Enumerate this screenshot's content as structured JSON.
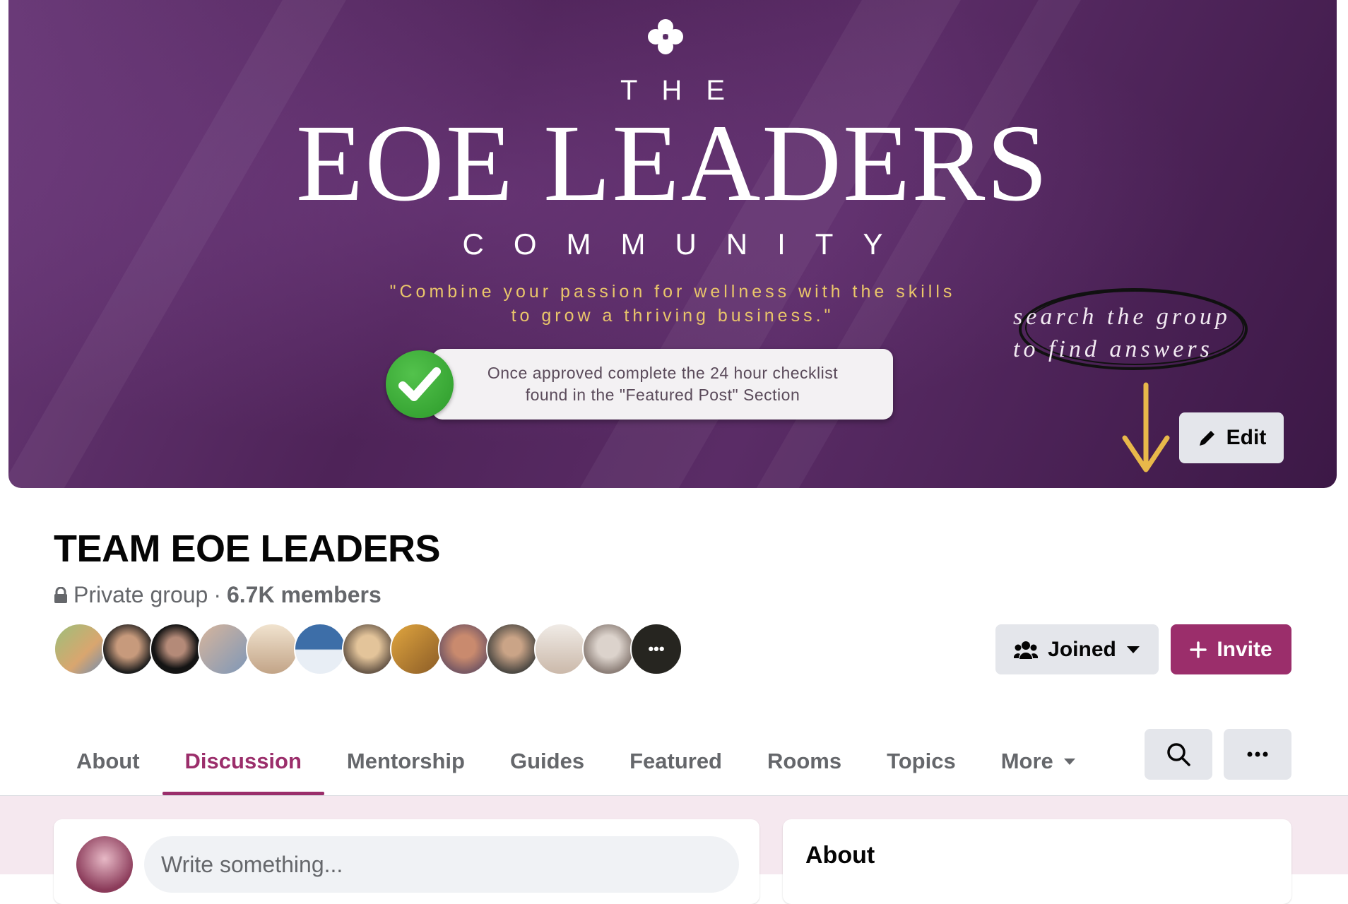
{
  "cover": {
    "the": "THE",
    "title": "EOE LEADERS",
    "community": "COMMUNITY",
    "quote_line1": "\"Combine your passion for wellness with the skills",
    "quote_line2": "to grow a thriving business.\"",
    "checklist_line1": "Once approved complete the 24 hour checklist",
    "checklist_line2": "found in the \"Featured Post\" Section",
    "script_line1": "search the group",
    "script_line2": "to find answers",
    "edit_label": "Edit",
    "colors": {
      "bg": "#4e2358",
      "quote": "#e9c56a",
      "arrow": "#e8b84a"
    }
  },
  "group": {
    "name": "TEAM EOE LEADERS",
    "privacy": "Private group",
    "separator": "·",
    "members": "6.7K members",
    "member_avatars_count": 13,
    "avatar_more": "•••"
  },
  "actions": {
    "joined_label": "Joined",
    "invite_label": "Invite",
    "invite_color": "#9b2e6b"
  },
  "tabs": [
    {
      "label": "About",
      "active": false
    },
    {
      "label": "Discussion",
      "active": true
    },
    {
      "label": "Mentorship",
      "active": false
    },
    {
      "label": "Guides",
      "active": false
    },
    {
      "label": "Featured",
      "active": false
    },
    {
      "label": "Rooms",
      "active": false
    },
    {
      "label": "Topics",
      "active": false
    },
    {
      "label": "More",
      "active": false
    }
  ],
  "composer": {
    "placeholder": "Write something..."
  },
  "about_card": {
    "heading": "About"
  }
}
